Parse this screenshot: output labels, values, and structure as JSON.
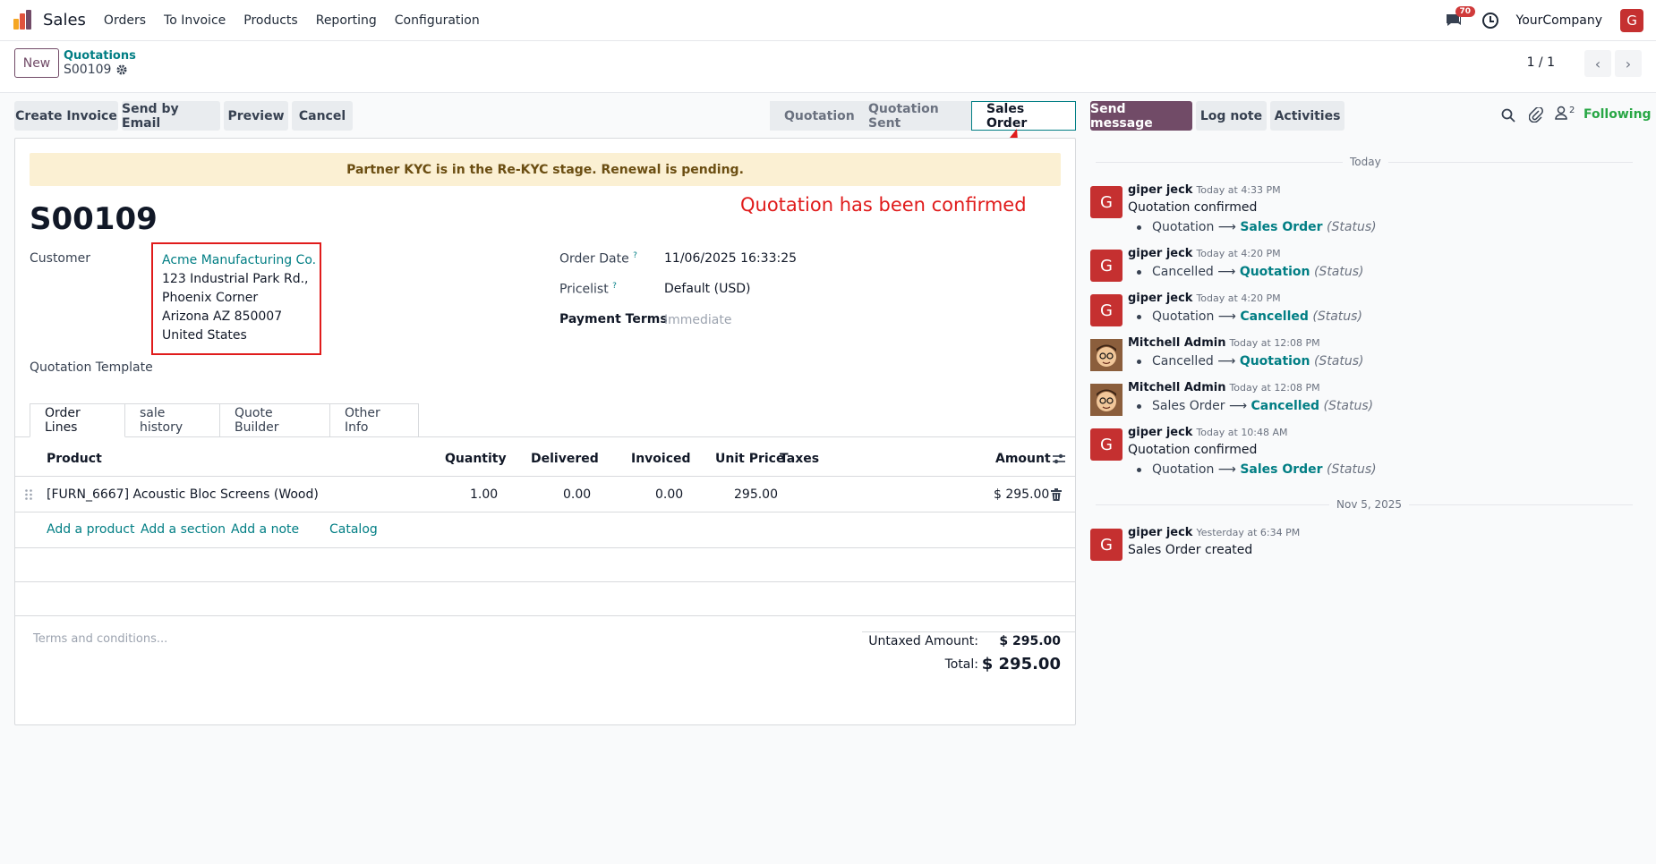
{
  "app": {
    "name": "Sales",
    "menu": [
      "Orders",
      "To Invoice",
      "Products",
      "Reporting",
      "Configuration"
    ],
    "notifications_count": "70",
    "company": "YourCompany",
    "user_initial": "G"
  },
  "control": {
    "new_label": "New",
    "breadcrumb_parent": "Quotations",
    "breadcrumb_current": "S00109",
    "pager": "1 / 1"
  },
  "actions": {
    "create_invoice": "Create Invoice",
    "send_by_email": "Send by Email",
    "preview": "Preview",
    "cancel": "Cancel"
  },
  "status": {
    "stages": [
      "Quotation",
      "Quotation Sent",
      "Sales Order"
    ],
    "active": "Sales Order"
  },
  "form": {
    "alert": "Partner KYC is in the Re-KYC stage. Renewal is pending.",
    "name": "S00109",
    "customer_label": "Customer",
    "customer": {
      "name": "Acme Manufacturing Co.",
      "address_lines": [
        "123 Industrial Park Rd.,",
        "Phoenix Corner",
        "Arizona AZ 850007",
        "United States"
      ]
    },
    "quotation_template_label": "Quotation Template",
    "order_date_label": "Order Date",
    "order_date": "11/06/2025 16:33:25",
    "pricelist_label": "Pricelist",
    "pricelist": "Default (USD)",
    "payment_terms_label": "Payment Terms",
    "payment_terms": "Immediate",
    "tooltip_mark": "?",
    "annotation": "Quotation has been confirmed"
  },
  "tabs": [
    "Order Lines",
    "sale history",
    "Quote Builder",
    "Other Info"
  ],
  "order_lines": {
    "columns": {
      "product": "Product",
      "quantity": "Quantity",
      "delivered": "Delivered",
      "invoiced": "Invoiced",
      "unit_price": "Unit Price",
      "taxes": "Taxes",
      "amount": "Amount"
    },
    "rows": [
      {
        "product": "[FURN_6667] Acoustic Bloc Screens (Wood)",
        "quantity": "1.00",
        "delivered": "0.00",
        "invoiced": "0.00",
        "unit_price": "295.00",
        "taxes": "",
        "amount": "$ 295.00"
      }
    ],
    "add_product": "Add a product",
    "add_section": "Add a section",
    "add_note": "Add a note",
    "catalog": "Catalog"
  },
  "totals": {
    "terms_placeholder": "Terms and conditions...",
    "untaxed_label": "Untaxed Amount:",
    "untaxed_value": "$ 295.00",
    "total_label": "Total:",
    "total_value": "$ 295.00"
  },
  "chatter": {
    "send_message": "Send message",
    "log_note": "Log note",
    "activities": "Activities",
    "followers_count": "2",
    "following": "Following",
    "arrow": "⟶",
    "status_field": "(Status)",
    "day_today": "Today",
    "day_prev": "Nov 5, 2025",
    "messages": [
      {
        "author": "giper jeck",
        "time": "Today at 4:33 PM",
        "avatar": "G",
        "body": "Quotation confirmed",
        "old": "Quotation",
        "new": "Sales Order"
      },
      {
        "author": "giper jeck",
        "time": "Today at 4:20 PM",
        "avatar": "G",
        "body": "",
        "old": "Cancelled",
        "new": "Quotation"
      },
      {
        "author": "giper jeck",
        "time": "Today at 4:20 PM",
        "avatar": "G",
        "body": "",
        "old": "Quotation",
        "new": "Cancelled"
      },
      {
        "author": "Mitchell Admin",
        "time": "Today at 12:08 PM",
        "avatar": "",
        "body": "",
        "old": "Cancelled",
        "new": "Quotation"
      },
      {
        "author": "Mitchell Admin",
        "time": "Today at 12:08 PM",
        "avatar": "",
        "body": "",
        "old": "Sales Order",
        "new": "Cancelled"
      },
      {
        "author": "giper jeck",
        "time": "Today at 10:48 AM",
        "avatar": "G",
        "body": "Quotation confirmed",
        "old": "Quotation",
        "new": "Sales Order"
      },
      {
        "author": "giper jeck",
        "time": "Yesterday at 6:34 PM",
        "avatar": "G",
        "body": "Sales Order created",
        "old": "",
        "new": ""
      }
    ]
  },
  "colors": {
    "brand": "#714b67",
    "link": "#017e84",
    "annotation": "#e01b1b",
    "following": "#28a745"
  }
}
